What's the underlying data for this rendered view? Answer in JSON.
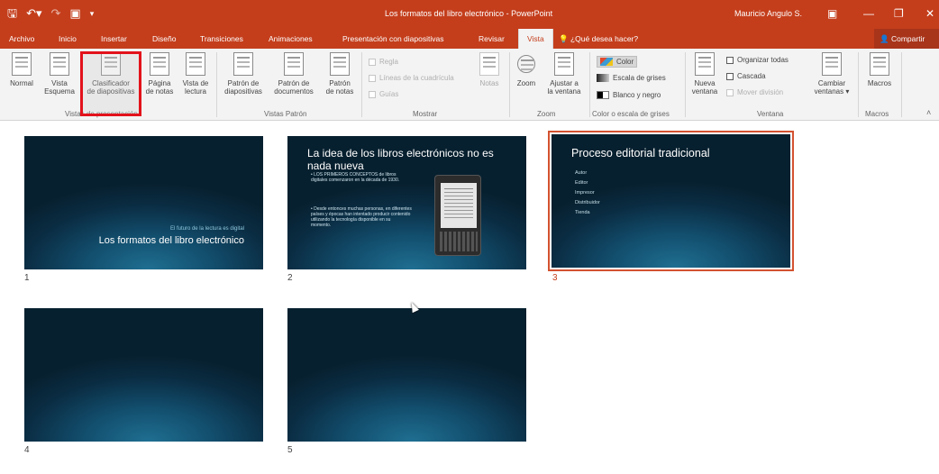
{
  "window": {
    "title": "Los formatos del libro electrónico - PowerPoint",
    "user": "Mauricio Angulo S.",
    "qat": {
      "save_icon": "save-icon",
      "undo_icon": "undo-icon",
      "redo_icon": "redo-icon",
      "start_icon": "start-presentation-icon",
      "customize_icon": "customize-qat-icon"
    },
    "controls": {
      "ribbon_options": "ribbon-display-options-icon",
      "minimize": "minimize-icon",
      "restore": "restore-icon",
      "close": "close-icon"
    }
  },
  "tabs": [
    {
      "label": "Archivo"
    },
    {
      "label": "Inicio"
    },
    {
      "label": "Insertar"
    },
    {
      "label": "Diseño"
    },
    {
      "label": "Transiciones"
    },
    {
      "label": "Animaciones"
    },
    {
      "label": "Presentación con diapositivas"
    },
    {
      "label": "Revisar"
    },
    {
      "label": "Vista",
      "active": true
    }
  ],
  "tell_me": "¿Qué desea hacer?",
  "share": "Compartir",
  "ribbon": {
    "groups": {
      "presentation_views": "Vistas de presentación",
      "master_views": "Vistas Patrón",
      "show": "Mostrar",
      "zoom": "Zoom",
      "color": "Color o escala de grises",
      "window": "Ventana",
      "macros": "Macros"
    },
    "buttons": {
      "normal": "Normal",
      "outline_1": "Vista",
      "outline_2": "Esquema",
      "sorter_1": "Clasificador",
      "sorter_2": "de diapositivas",
      "notes_page_1": "Página",
      "notes_page_2": "de notas",
      "reading_1": "Vista de",
      "reading_2": "lectura",
      "slide_master_1": "Patrón de",
      "slide_master_2": "diapositivas",
      "handout_master_1": "Patrón de",
      "handout_master_2": "documentos",
      "notes_master_1": "Patrón",
      "notes_master_2": "de notas",
      "ruler": "Regla",
      "gridlines": "Líneas de la cuadrícula",
      "guides": "Guías",
      "notes": "Notas",
      "zoom": "Zoom",
      "fit_1": "Ajustar a",
      "fit_2": "la ventana",
      "color": "Color",
      "grayscale": "Escala de grises",
      "black_white": "Blanco y negro",
      "new_window_1": "Nueva",
      "new_window_2": "ventana",
      "arrange_all": "Organizar todas",
      "cascade": "Cascada",
      "move_split": "Mover división",
      "switch_1": "Cambiar",
      "switch_2": "ventanas",
      "macros": "Macros"
    }
  },
  "slides": [
    {
      "num": "1",
      "subtitle": "El futuro de la lectura es digital",
      "title": "Los formatos del libro electrónico"
    },
    {
      "num": "2",
      "title": "La idea de los libros electrónicos no es nada nueva",
      "bullets": [
        "• LOS PRIMEROS CONCEPTOS de libros digitales comenzaron en la década de 1930.",
        "• Desde entonces muchas personas, en diferentes países y épocas han intentado producir contenido utilizando la tecnología disponible en su momento."
      ]
    },
    {
      "num": "3",
      "title": "Proceso editorial tradicional",
      "selected": true,
      "items": [
        "Autor",
        "Editor",
        "Impresor",
        "Distribuidor",
        "Tienda"
      ]
    },
    {
      "num": "4"
    },
    {
      "num": "5"
    }
  ],
  "colors": {
    "accent": "#c43e1c",
    "selection": "#d35230",
    "highlight": "#e3121b",
    "slide_bg": "#0d3550"
  }
}
